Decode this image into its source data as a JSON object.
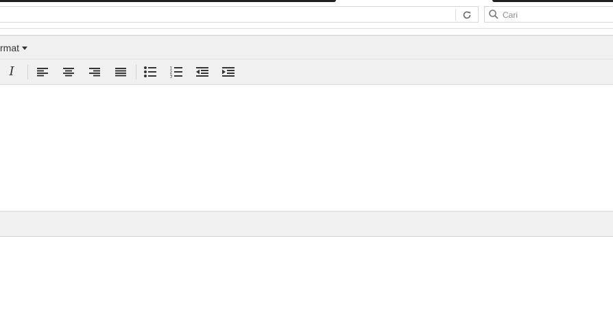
{
  "search": {
    "placeholder": "Cari"
  },
  "editor": {
    "menubar": {
      "format_label": "rmat"
    },
    "toolbar": {
      "buttons": [
        {
          "name": "italic",
          "icon": "italic-icon"
        },
        {
          "name": "align-left",
          "icon": "align-left-icon"
        },
        {
          "name": "align-center",
          "icon": "align-center-icon"
        },
        {
          "name": "align-right",
          "icon": "align-right-icon"
        },
        {
          "name": "align-justify",
          "icon": "align-justify-icon"
        },
        {
          "name": "bullet-list",
          "icon": "bullet-list-icon"
        },
        {
          "name": "numbered-list",
          "icon": "numbered-list-icon"
        },
        {
          "name": "outdent",
          "icon": "outdent-icon"
        },
        {
          "name": "indent",
          "icon": "indent-icon"
        }
      ]
    }
  },
  "colors": {
    "toolbar_bg": "#f0f0f0",
    "border": "#cfcfcf",
    "icon": "#333333"
  }
}
